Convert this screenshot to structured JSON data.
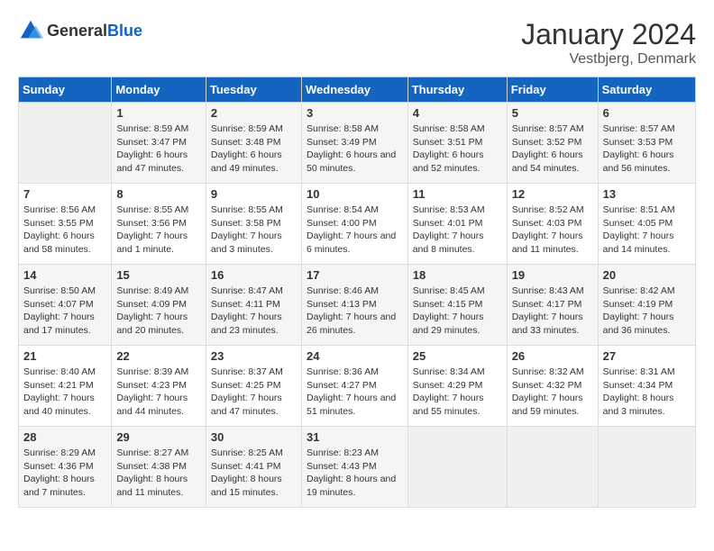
{
  "header": {
    "logo_general": "General",
    "logo_blue": "Blue",
    "month": "January 2024",
    "location": "Vestbjerg, Denmark"
  },
  "days_of_week": [
    "Sunday",
    "Monday",
    "Tuesday",
    "Wednesday",
    "Thursday",
    "Friday",
    "Saturday"
  ],
  "weeks": [
    [
      {
        "day": "",
        "empty": true
      },
      {
        "day": "1",
        "sunrise": "Sunrise: 8:59 AM",
        "sunset": "Sunset: 3:47 PM",
        "daylight": "Daylight: 6 hours and 47 minutes."
      },
      {
        "day": "2",
        "sunrise": "Sunrise: 8:59 AM",
        "sunset": "Sunset: 3:48 PM",
        "daylight": "Daylight: 6 hours and 49 minutes."
      },
      {
        "day": "3",
        "sunrise": "Sunrise: 8:58 AM",
        "sunset": "Sunset: 3:49 PM",
        "daylight": "Daylight: 6 hours and 50 minutes."
      },
      {
        "day": "4",
        "sunrise": "Sunrise: 8:58 AM",
        "sunset": "Sunset: 3:51 PM",
        "daylight": "Daylight: 6 hours and 52 minutes."
      },
      {
        "day": "5",
        "sunrise": "Sunrise: 8:57 AM",
        "sunset": "Sunset: 3:52 PM",
        "daylight": "Daylight: 6 hours and 54 minutes."
      },
      {
        "day": "6",
        "sunrise": "Sunrise: 8:57 AM",
        "sunset": "Sunset: 3:53 PM",
        "daylight": "Daylight: 6 hours and 56 minutes."
      }
    ],
    [
      {
        "day": "7",
        "sunrise": "Sunrise: 8:56 AM",
        "sunset": "Sunset: 3:55 PM",
        "daylight": "Daylight: 6 hours and 58 minutes."
      },
      {
        "day": "8",
        "sunrise": "Sunrise: 8:55 AM",
        "sunset": "Sunset: 3:56 PM",
        "daylight": "Daylight: 7 hours and 1 minute."
      },
      {
        "day": "9",
        "sunrise": "Sunrise: 8:55 AM",
        "sunset": "Sunset: 3:58 PM",
        "daylight": "Daylight: 7 hours and 3 minutes."
      },
      {
        "day": "10",
        "sunrise": "Sunrise: 8:54 AM",
        "sunset": "Sunset: 4:00 PM",
        "daylight": "Daylight: 7 hours and 6 minutes."
      },
      {
        "day": "11",
        "sunrise": "Sunrise: 8:53 AM",
        "sunset": "Sunset: 4:01 PM",
        "daylight": "Daylight: 7 hours and 8 minutes."
      },
      {
        "day": "12",
        "sunrise": "Sunrise: 8:52 AM",
        "sunset": "Sunset: 4:03 PM",
        "daylight": "Daylight: 7 hours and 11 minutes."
      },
      {
        "day": "13",
        "sunrise": "Sunrise: 8:51 AM",
        "sunset": "Sunset: 4:05 PM",
        "daylight": "Daylight: 7 hours and 14 minutes."
      }
    ],
    [
      {
        "day": "14",
        "sunrise": "Sunrise: 8:50 AM",
        "sunset": "Sunset: 4:07 PM",
        "daylight": "Daylight: 7 hours and 17 minutes."
      },
      {
        "day": "15",
        "sunrise": "Sunrise: 8:49 AM",
        "sunset": "Sunset: 4:09 PM",
        "daylight": "Daylight: 7 hours and 20 minutes."
      },
      {
        "day": "16",
        "sunrise": "Sunrise: 8:47 AM",
        "sunset": "Sunset: 4:11 PM",
        "daylight": "Daylight: 7 hours and 23 minutes."
      },
      {
        "day": "17",
        "sunrise": "Sunrise: 8:46 AM",
        "sunset": "Sunset: 4:13 PM",
        "daylight": "Daylight: 7 hours and 26 minutes."
      },
      {
        "day": "18",
        "sunrise": "Sunrise: 8:45 AM",
        "sunset": "Sunset: 4:15 PM",
        "daylight": "Daylight: 7 hours and 29 minutes."
      },
      {
        "day": "19",
        "sunrise": "Sunrise: 8:43 AM",
        "sunset": "Sunset: 4:17 PM",
        "daylight": "Daylight: 7 hours and 33 minutes."
      },
      {
        "day": "20",
        "sunrise": "Sunrise: 8:42 AM",
        "sunset": "Sunset: 4:19 PM",
        "daylight": "Daylight: 7 hours and 36 minutes."
      }
    ],
    [
      {
        "day": "21",
        "sunrise": "Sunrise: 8:40 AM",
        "sunset": "Sunset: 4:21 PM",
        "daylight": "Daylight: 7 hours and 40 minutes."
      },
      {
        "day": "22",
        "sunrise": "Sunrise: 8:39 AM",
        "sunset": "Sunset: 4:23 PM",
        "daylight": "Daylight: 7 hours and 44 minutes."
      },
      {
        "day": "23",
        "sunrise": "Sunrise: 8:37 AM",
        "sunset": "Sunset: 4:25 PM",
        "daylight": "Daylight: 7 hours and 47 minutes."
      },
      {
        "day": "24",
        "sunrise": "Sunrise: 8:36 AM",
        "sunset": "Sunset: 4:27 PM",
        "daylight": "Daylight: 7 hours and 51 minutes."
      },
      {
        "day": "25",
        "sunrise": "Sunrise: 8:34 AM",
        "sunset": "Sunset: 4:29 PM",
        "daylight": "Daylight: 7 hours and 55 minutes."
      },
      {
        "day": "26",
        "sunrise": "Sunrise: 8:32 AM",
        "sunset": "Sunset: 4:32 PM",
        "daylight": "Daylight: 7 hours and 59 minutes."
      },
      {
        "day": "27",
        "sunrise": "Sunrise: 8:31 AM",
        "sunset": "Sunset: 4:34 PM",
        "daylight": "Daylight: 8 hours and 3 minutes."
      }
    ],
    [
      {
        "day": "28",
        "sunrise": "Sunrise: 8:29 AM",
        "sunset": "Sunset: 4:36 PM",
        "daylight": "Daylight: 8 hours and 7 minutes."
      },
      {
        "day": "29",
        "sunrise": "Sunrise: 8:27 AM",
        "sunset": "Sunset: 4:38 PM",
        "daylight": "Daylight: 8 hours and 11 minutes."
      },
      {
        "day": "30",
        "sunrise": "Sunrise: 8:25 AM",
        "sunset": "Sunset: 4:41 PM",
        "daylight": "Daylight: 8 hours and 15 minutes."
      },
      {
        "day": "31",
        "sunrise": "Sunrise: 8:23 AM",
        "sunset": "Sunset: 4:43 PM",
        "daylight": "Daylight: 8 hours and 19 minutes."
      },
      {
        "day": "",
        "empty": true
      },
      {
        "day": "",
        "empty": true
      },
      {
        "day": "",
        "empty": true
      }
    ]
  ]
}
